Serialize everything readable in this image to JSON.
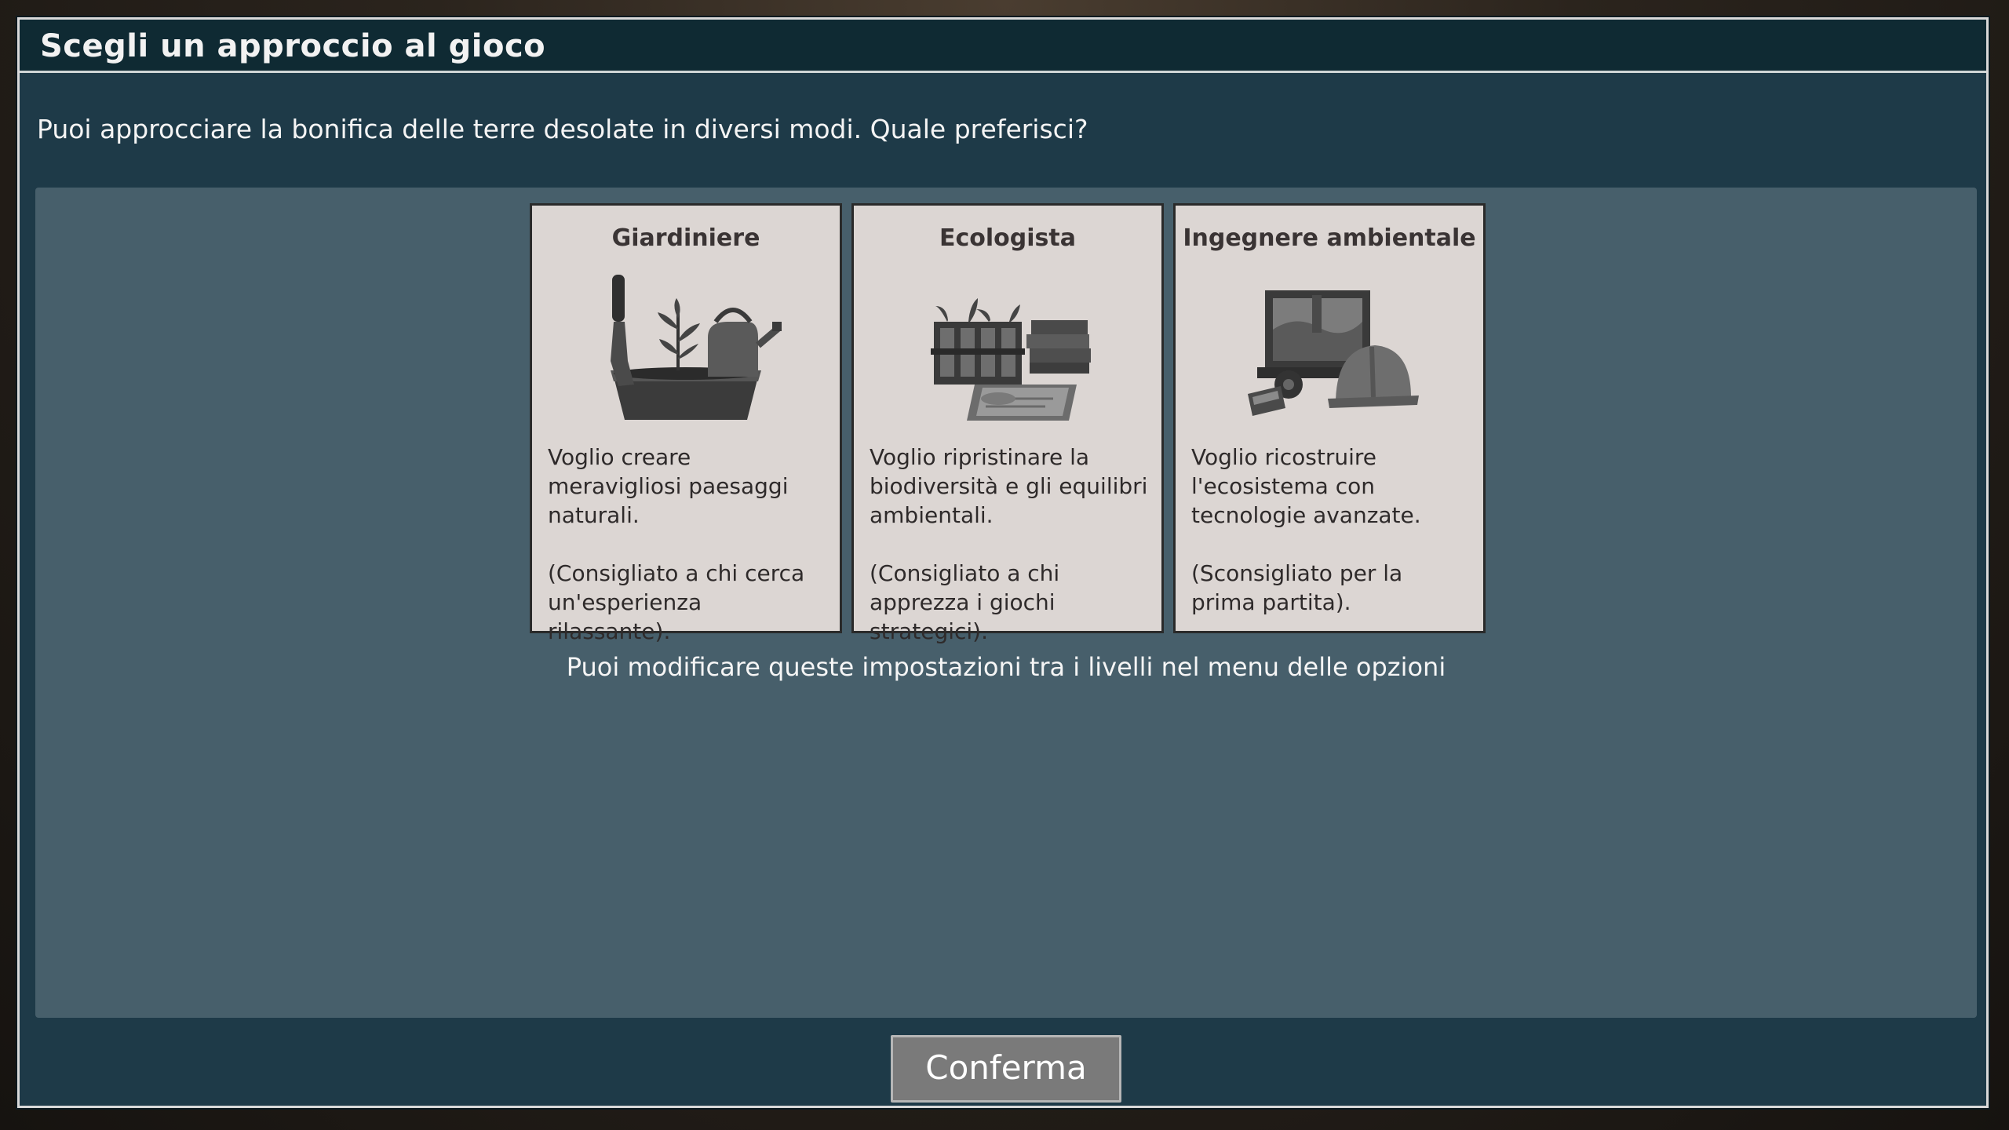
{
  "dialog": {
    "title": "Scegli un approccio al gioco",
    "subtitle": "Puoi approcciare la bonifica delle terre desolate in diversi modi. Quale preferisci?",
    "footer_note": "Puoi modificare queste impostazioni tra i livelli nel menu delle opzioni",
    "confirm_label": "Conferma"
  },
  "cards": [
    {
      "title": "Giardiniere",
      "icon": "gardening-tools-icon",
      "description": "Voglio creare meravigliosi paesaggi naturali.\n\n(Consigliato a chi cerca un'esperienza rilassante)."
    },
    {
      "title": "Ecologista",
      "icon": "ecology-research-icon",
      "description": "Voglio ripristinare la biodiversità e gli equilibri ambientali.\n\n(Consigliato a chi apprezza i giochi strategici)."
    },
    {
      "title": "Ingegnere ambientale",
      "icon": "engineering-tools-icon",
      "description": "Voglio ricostruire l'ecosistema con tecnologie avanzate.\n\n(Sconsigliato per la prima partita)."
    }
  ],
  "colors": {
    "dialog_bg": "#1e3a48",
    "title_bar_bg": "#0f2a33",
    "panel_bg": "#475f6b",
    "card_bg": "#dcd6d3",
    "button_bg": "#7a7a7a"
  }
}
